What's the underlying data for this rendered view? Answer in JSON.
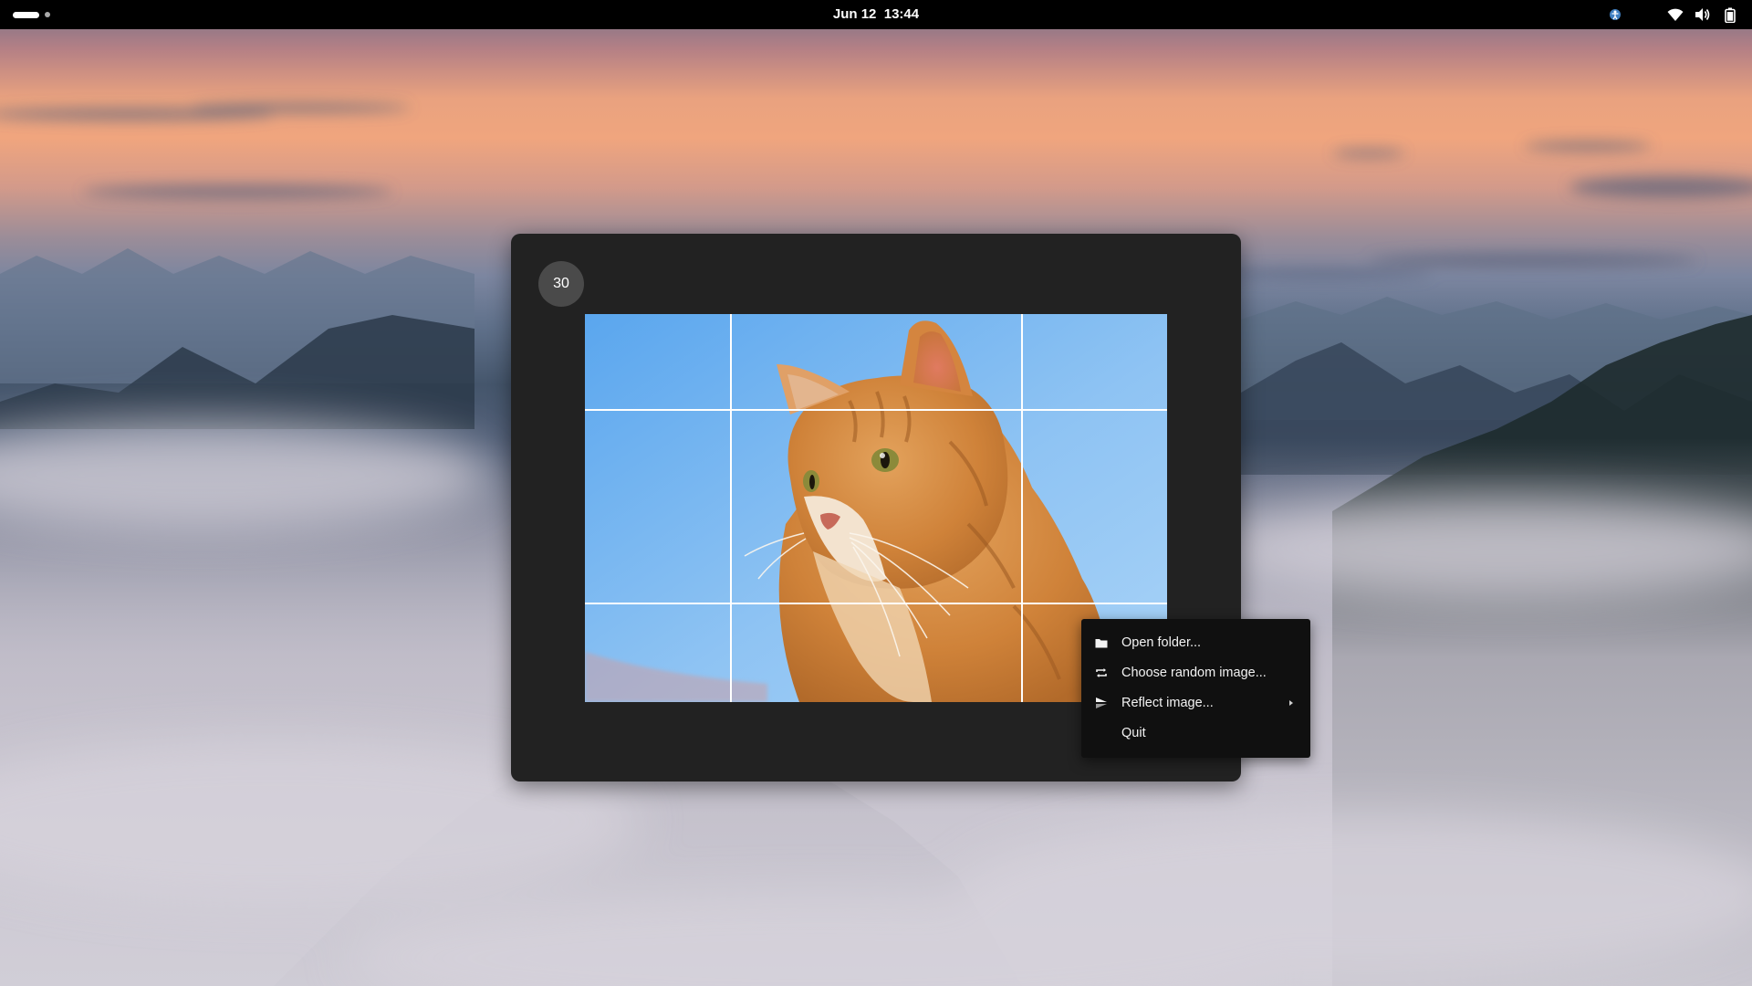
{
  "topbar": {
    "date": "Jun 12",
    "time": "13:44",
    "tray_icons": [
      "accessibility-icon",
      "wifi-icon",
      "volume-icon",
      "battery-icon"
    ]
  },
  "window": {
    "countdown": "30"
  },
  "context_menu": {
    "items": [
      {
        "label": "Open folder...",
        "icon": "folder-icon"
      },
      {
        "label": "Choose random image...",
        "icon": "shuffle-icon"
      },
      {
        "label": "Reflect image...",
        "icon": "reflect-icon",
        "has_submenu": true
      },
      {
        "label": "Quit"
      }
    ]
  },
  "colors": {
    "topbar": "#000000",
    "window_bg": "#222222",
    "countdown_bg": "#4a4a4a",
    "menu_bg": "#101010",
    "sky_blue": "#8ec0ef",
    "cat_orange": "#d8883f"
  }
}
